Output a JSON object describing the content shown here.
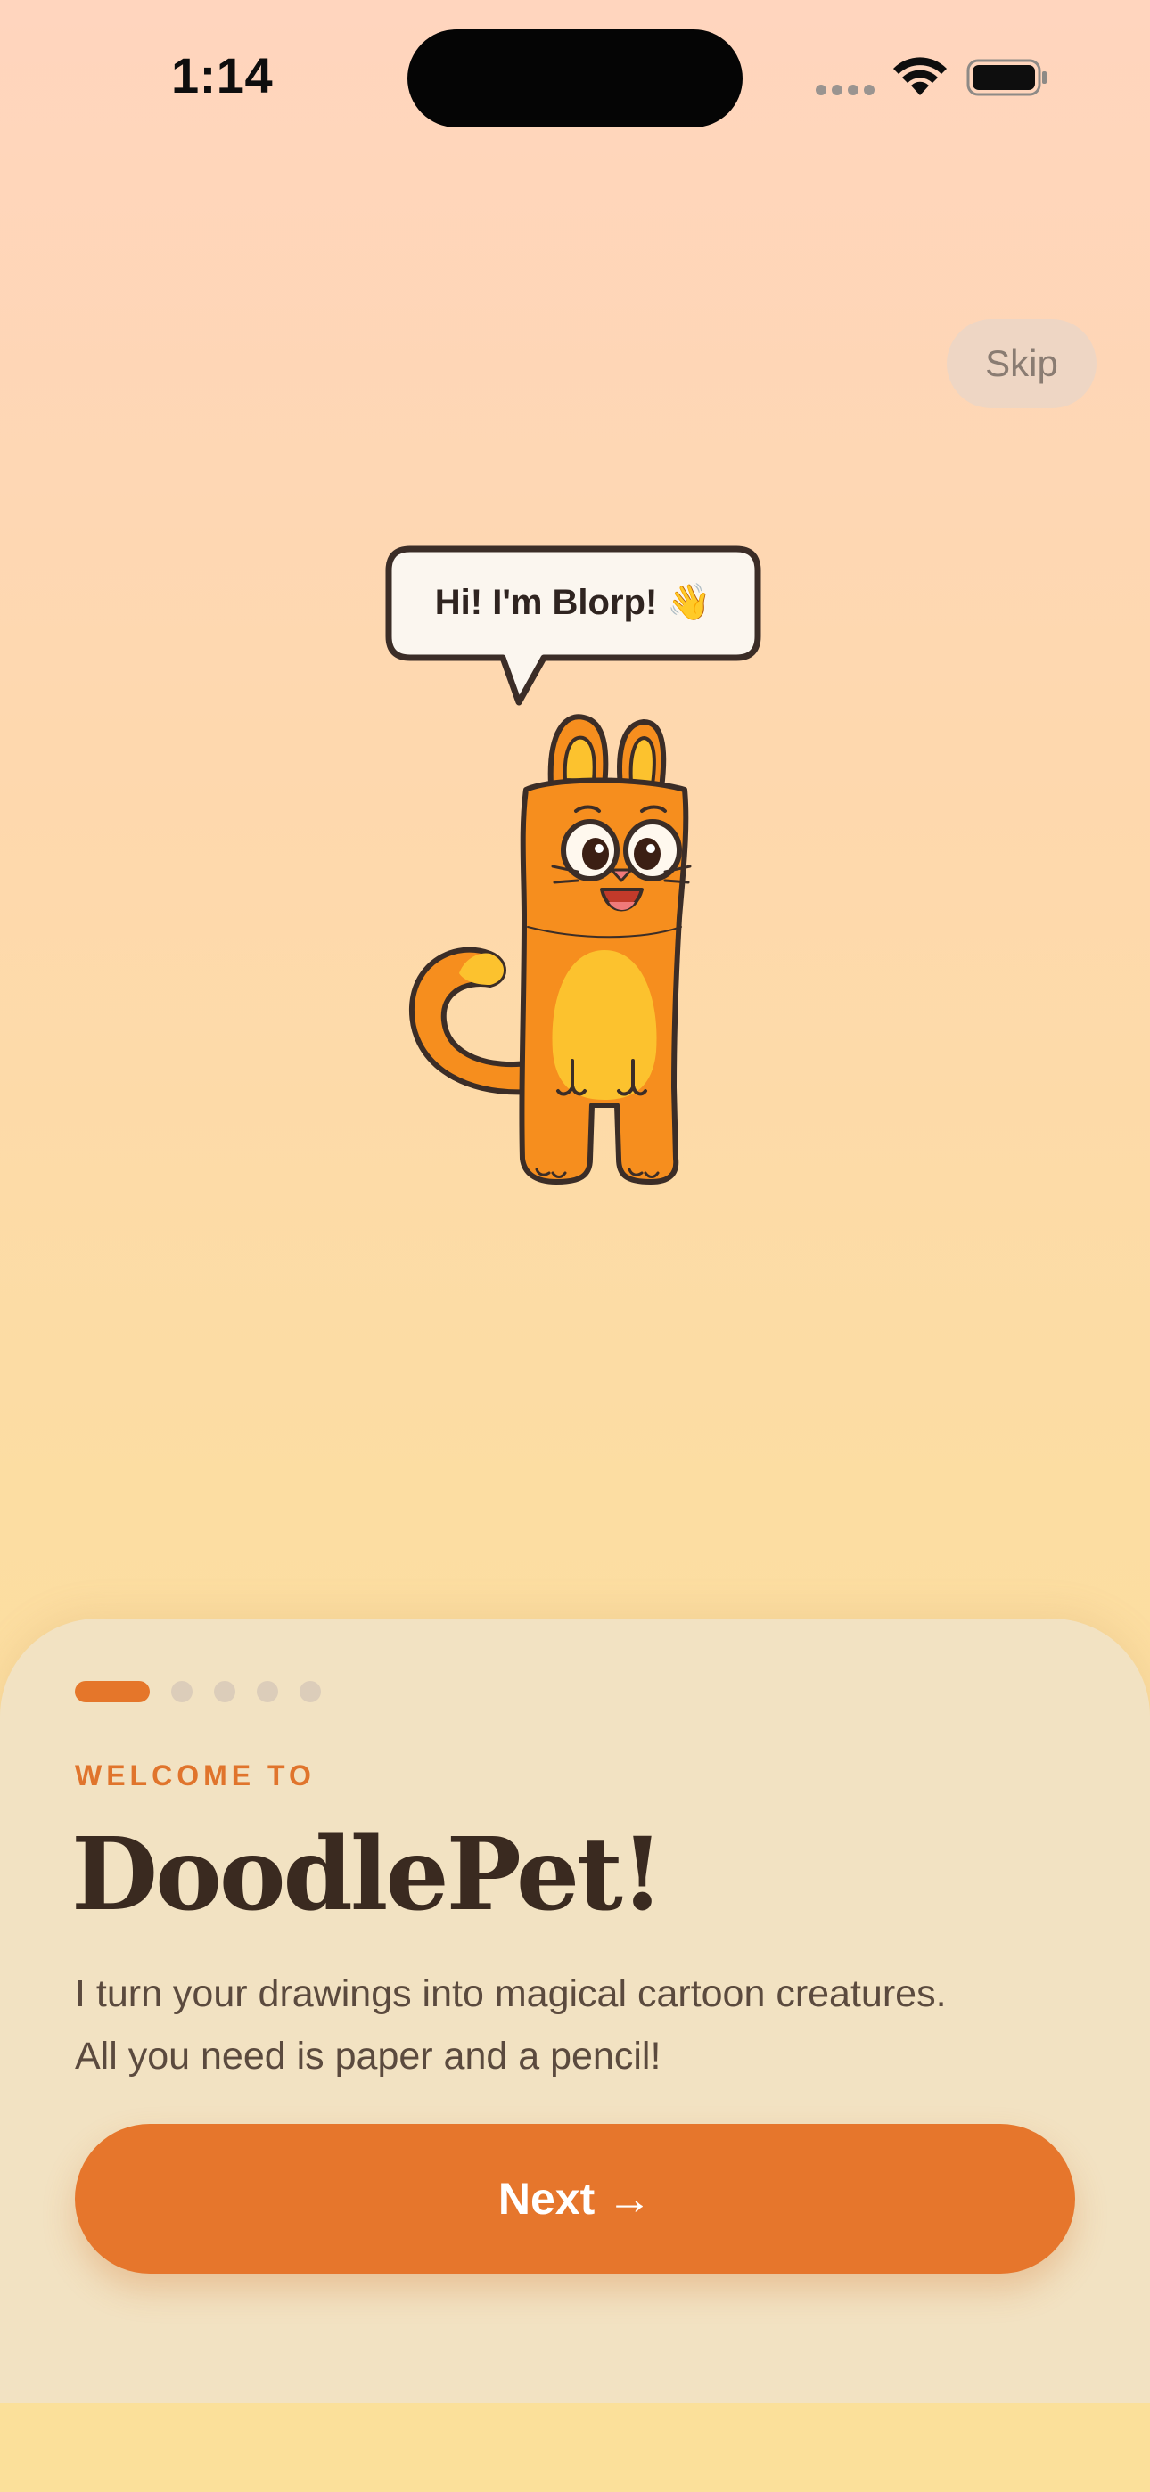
{
  "status_bar": {
    "time": "1:14",
    "icons": [
      "cellular-dots-icon",
      "wifi-icon",
      "battery-icon"
    ]
  },
  "skip": {
    "label": "Skip"
  },
  "mascot": {
    "speech": "Hi! I'm Blorp! 👋",
    "icon": "orange-cat-mascot-illustration"
  },
  "onboarding": {
    "page_index": 1,
    "page_count": 5,
    "eyebrow": "WELCOME TO",
    "title": "DoodlePet!",
    "body_lines": [
      "I turn your drawings into magical cartoon creatures.",
      "All you need is paper and a pencil!"
    ],
    "next_label": "Next →"
  },
  "colors": {
    "accent": "#E6762C",
    "background_top": "#FFD5BE",
    "background_bottom": "#FBE19A",
    "card": "#F2E2C2",
    "text_dark": "#3A2A20"
  }
}
